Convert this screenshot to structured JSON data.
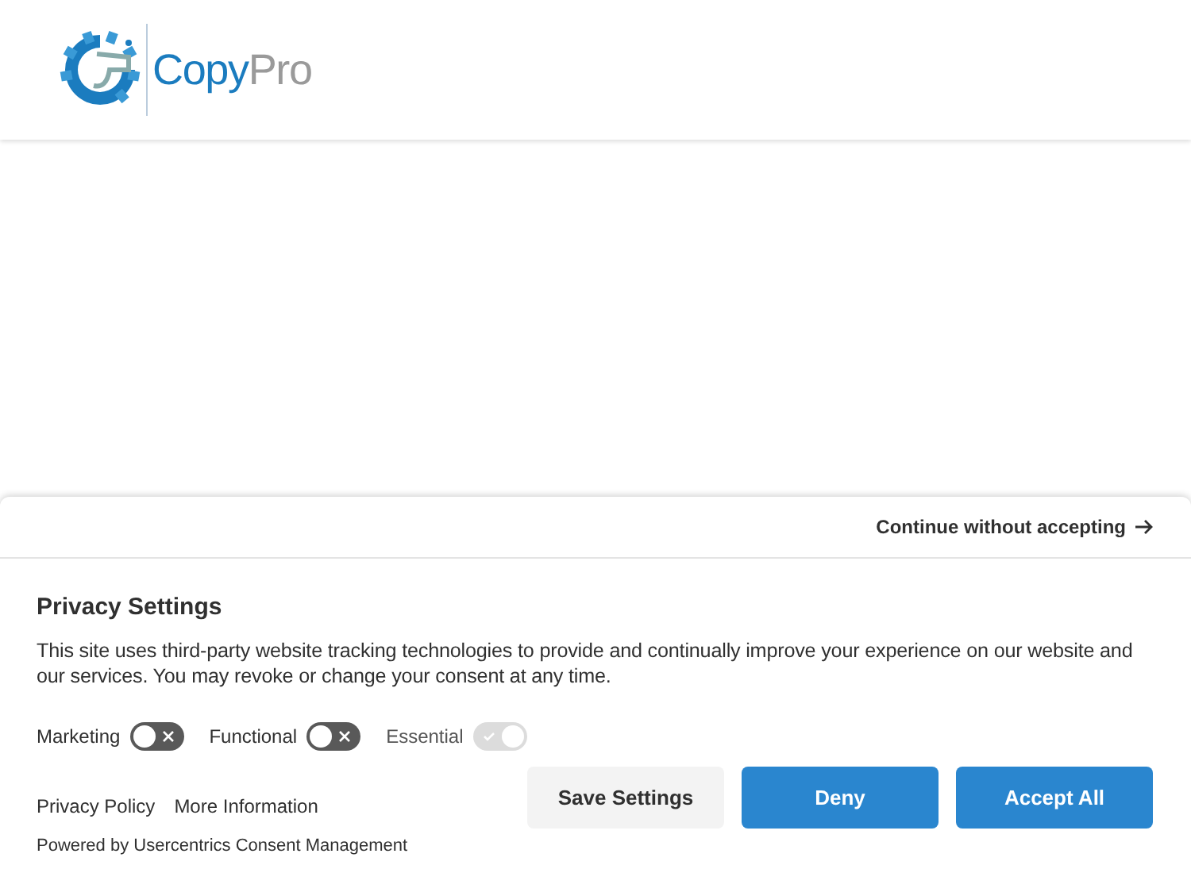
{
  "logo": {
    "primary": "Copy",
    "secondary": "Pro"
  },
  "consent": {
    "continue_link": "Continue without accepting",
    "title": "Privacy Settings",
    "description": "This site uses third-party website tracking technologies to provide and continually improve your experience on our website and our services. You may revoke or change your consent at any time.",
    "toggles": [
      {
        "label": "Marketing",
        "on": false,
        "disabled": false
      },
      {
        "label": "Functional",
        "on": false,
        "disabled": false
      },
      {
        "label": "Essential",
        "on": true,
        "disabled": true
      }
    ],
    "links": [
      "Privacy Policy",
      "More Information"
    ],
    "powered_by": "Powered by Usercentrics Consent Management",
    "buttons": [
      {
        "label": "Save Settings",
        "kind": "secondary"
      },
      {
        "label": "Deny",
        "kind": "primary"
      },
      {
        "label": "Accept All",
        "kind": "primary"
      }
    ]
  }
}
